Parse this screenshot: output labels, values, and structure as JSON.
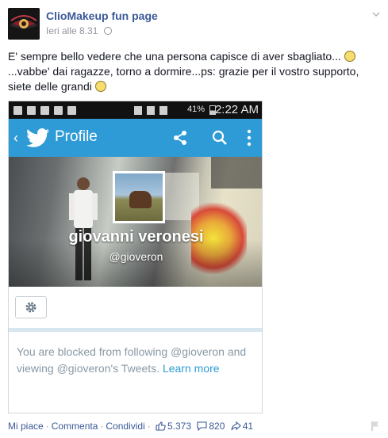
{
  "post": {
    "page_name": "ClioMakeup fun page",
    "timestamp": "Ieri alle 8.31",
    "text_line1": "E' sempre bello vedere che una persona capisce di aver sbagliato...",
    "text_line2": "...vabbe' dai ragazze, torno a dormire...ps: grazie per il vostro supporto,",
    "text_line3": "siete delle grandi"
  },
  "screenshot": {
    "status_battery": "41%",
    "status_time": "2:22 AM",
    "app_title": "Profile",
    "display_name": "giovanni veronesi",
    "handle": "@gioveron",
    "blocked_line1": "You are blocked from following @gioveron and",
    "blocked_line2": "viewing @gioveron's Tweets.",
    "learn_more": "Learn more"
  },
  "actions": {
    "like": "Mi piace",
    "comment": "Commenta",
    "share": "Condividi",
    "likes_count": "5.373",
    "comments_count": "820",
    "shares_count": "41"
  },
  "colors": {
    "facebook_blue": "#3b5998",
    "twitter_blue": "#2e9bd6"
  }
}
